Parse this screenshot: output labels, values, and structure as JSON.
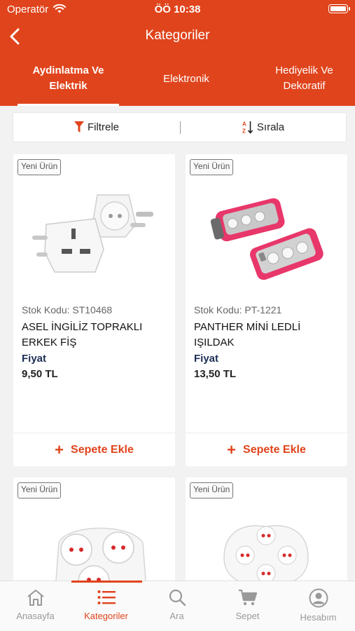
{
  "status_bar": {
    "carrier": "Operatör",
    "time": "ÖÖ 10:38"
  },
  "nav": {
    "title": "Kategoriler"
  },
  "tabs": [
    {
      "label": "Aydinlatma Ve Elektrik",
      "active": true
    },
    {
      "label": "Elektronik",
      "active": false
    },
    {
      "label": "Hediyelik Ve Dekoratif",
      "active": false
    }
  ],
  "toolbar": {
    "filter_label": "Filtrele",
    "sort_label": "Sırala"
  },
  "products": [
    {
      "badge": "Yeni Ürün",
      "stock": "Stok Kodu: ST10468",
      "name": "ASEL İNGİLİZ TOPRAKLI ERKEK FİŞ",
      "price_label": "Fiyat",
      "price": "9,50 TL",
      "add_label": "Sepete Ekle"
    },
    {
      "badge": "Yeni Ürün",
      "stock": "Stok Kodu: PT-1221",
      "name": "PANTHER MİNİ LEDLİ IŞILDAK",
      "price_label": "Fiyat",
      "price": "13,50 TL",
      "add_label": "Sepete Ekle"
    },
    {
      "badge": "Yeni Ürün"
    },
    {
      "badge": "Yeni Ürün"
    }
  ],
  "bottom_tabs": [
    {
      "label": "Anasayfa",
      "icon": "home-icon",
      "active": false
    },
    {
      "label": "Kategoriler",
      "icon": "list-icon",
      "active": true
    },
    {
      "label": "Ara",
      "icon": "search-icon",
      "active": false
    },
    {
      "label": "Sepet",
      "icon": "cart-icon",
      "active": false
    },
    {
      "label": "Hesabım",
      "icon": "account-icon",
      "active": false
    }
  ],
  "colors": {
    "accent": "#e0441c",
    "price_label": "#1d2e55"
  }
}
